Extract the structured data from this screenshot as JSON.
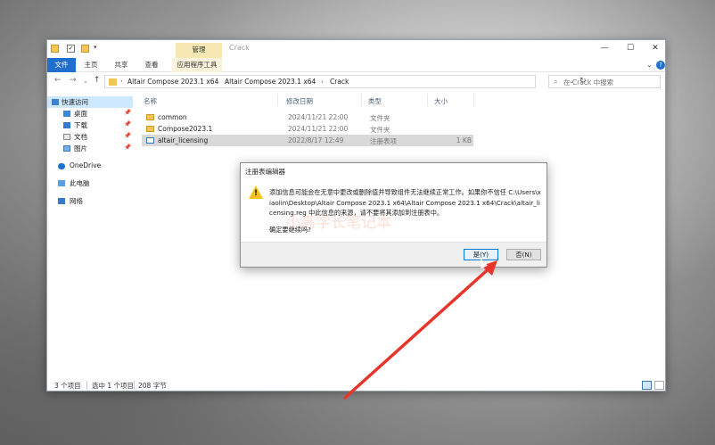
{
  "window": {
    "title": "Crack",
    "context_tab": "管理",
    "controls": {
      "minimize": "—",
      "maximize": "☐",
      "close": "✕"
    }
  },
  "ribbon": {
    "tabs": {
      "file": "文件",
      "home": "主页",
      "share": "共享",
      "view": "查看",
      "tools": "应用程序工具"
    },
    "collapse": "⌄",
    "help": "?"
  },
  "address": {
    "crumbs": [
      "Altair Compose 2023.1 x64",
      "Altair Compose 2023.1 x64",
      "Crack"
    ],
    "separator": "›",
    "search_placeholder": "在 Crack 中搜索"
  },
  "nav": {
    "back": "←",
    "forward": "→",
    "recent": "⌄",
    "up": "↑",
    "refresh": "↻",
    "pin": "📌",
    "items": [
      {
        "label": "快速访问",
        "icon": "star-icon"
      },
      {
        "label": "桌面",
        "icon": "desktop-icon"
      },
      {
        "label": "下载",
        "icon": "download-icon"
      },
      {
        "label": "文档",
        "icon": "documents-icon"
      },
      {
        "label": "图片",
        "icon": "pictures-icon"
      },
      {
        "label": "OneDrive",
        "icon": "cloud-icon"
      },
      {
        "label": "此电脑",
        "icon": "computer-icon"
      },
      {
        "label": "网络",
        "icon": "network-icon"
      }
    ]
  },
  "files": {
    "headers": {
      "name": "名称",
      "date": "修改日期",
      "type": "类型",
      "size": "大小"
    },
    "rows": [
      {
        "name": "common",
        "date": "2024/11/21 22:00",
        "type": "文件夹",
        "size": "",
        "icon": "folder-icon"
      },
      {
        "name": "Compose2023.1",
        "date": "2024/11/21 22:00",
        "type": "文件夹",
        "size": "",
        "icon": "folder-icon"
      },
      {
        "name": "altair_licensing",
        "date": "2022/8/17 12:49",
        "type": "注册表项",
        "size": "1 KB",
        "icon": "registry-file-icon"
      }
    ]
  },
  "status": {
    "count": "3 个项目",
    "selected": "选中 1 个项目",
    "size": "208 字节"
  },
  "dialog": {
    "title": "注册表编辑器",
    "message": "添加信息可能会在无意中更改或删除值并导致组件无法继续正常工作。如果你不信任 C:\\Users\\xiaolin\\Desktop\\Altair Compose 2023.1 x64\\Altair Compose 2023.1 x64\\Crack\\altair_licensing.reg 中此信息的来源，请不要将其添加到注册表中。",
    "question": "确定要继续吗?",
    "watermark": "小高学长笔记本",
    "yes": "是(Y)",
    "no": "否(N)"
  },
  "colors": {
    "accent": "#1f6fd0",
    "warning": "#f4c21b",
    "annotation_arrow": "#e8352b"
  }
}
